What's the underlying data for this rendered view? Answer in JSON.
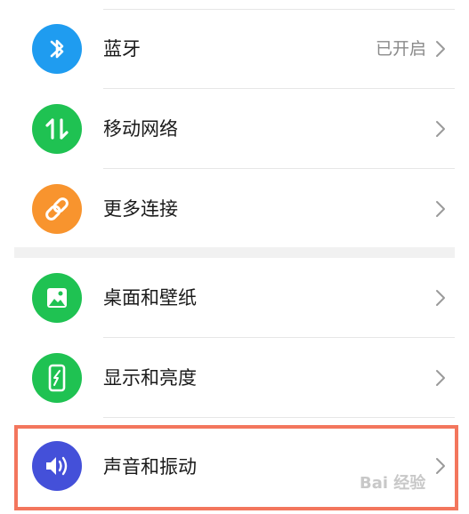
{
  "settings": {
    "items": [
      {
        "label": "蓝牙",
        "value": "已开启",
        "icon": "bluetooth-icon",
        "color": "#1f9cf0"
      },
      {
        "label": "移动网络",
        "icon": "mobile-data-icon",
        "color": "#1fc252"
      },
      {
        "label": "更多连接",
        "icon": "link-icon",
        "color": "#f8942e"
      },
      {
        "label": "桌面和壁纸",
        "icon": "wallpaper-icon",
        "color": "#1fc252"
      },
      {
        "label": "显示和亮度",
        "icon": "display-icon",
        "color": "#1fc252"
      },
      {
        "label": "声音和振动",
        "icon": "sound-icon",
        "color": "#4450d9"
      }
    ]
  },
  "highlight_color": "#f3765d",
  "watermark": "Bai 经验"
}
